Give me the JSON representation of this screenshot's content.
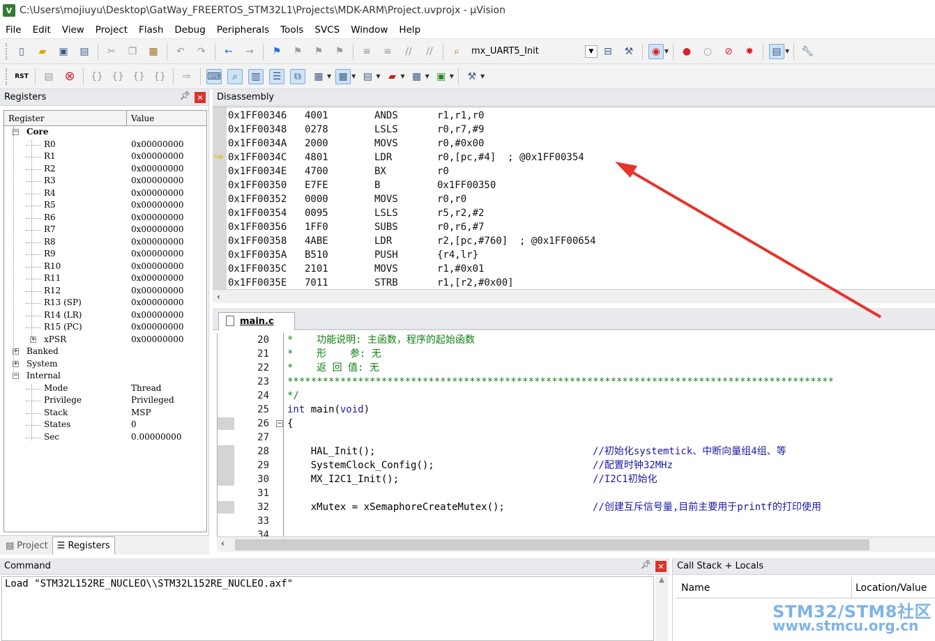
{
  "window": {
    "title": "C:\\Users\\mojiuyu\\Desktop\\GatWay_FREERTOS_STM32L1\\Projects\\MDK-ARM\\Project.uvprojx - µVision",
    "app_icon": "V"
  },
  "menu": [
    "File",
    "Edit",
    "View",
    "Project",
    "Flash",
    "Debug",
    "Peripherals",
    "Tools",
    "SVCS",
    "Window",
    "Help"
  ],
  "toolbar": {
    "target": "mx_UART5_Init"
  },
  "registers": {
    "title": "Registers",
    "col_register": "Register",
    "col_value": "Value",
    "core_label": "Core",
    "core": [
      {
        "name": "R0",
        "value": "0x00000000"
      },
      {
        "name": "R1",
        "value": "0x00000000"
      },
      {
        "name": "R2",
        "value": "0x00000000"
      },
      {
        "name": "R3",
        "value": "0x00000000"
      },
      {
        "name": "R4",
        "value": "0x00000000"
      },
      {
        "name": "R5",
        "value": "0x00000000"
      },
      {
        "name": "R6",
        "value": "0x00000000"
      },
      {
        "name": "R7",
        "value": "0x00000000"
      },
      {
        "name": "R8",
        "value": "0x00000000"
      },
      {
        "name": "R9",
        "value": "0x00000000"
      },
      {
        "name": "R10",
        "value": "0x00000000"
      },
      {
        "name": "R11",
        "value": "0x00000000"
      },
      {
        "name": "R12",
        "value": "0x00000000"
      },
      {
        "name": "R13 (SP)",
        "value": "0x00000000"
      },
      {
        "name": "R14 (LR)",
        "value": "0x00000000"
      },
      {
        "name": "R15 (PC)",
        "value": "0x00000000"
      },
      {
        "name": "xPSR",
        "value": "0x00000000"
      }
    ],
    "banked_label": "Banked",
    "system_label": "System",
    "internal_label": "Internal",
    "internal": [
      {
        "name": "Mode",
        "value": "Thread"
      },
      {
        "name": "Privilege",
        "value": "Privileged"
      },
      {
        "name": "Stack",
        "value": "MSP"
      },
      {
        "name": "States",
        "value": "0"
      },
      {
        "name": "Sec",
        "value": "0.00000000"
      }
    ],
    "tabs": [
      "Project",
      "Registers"
    ]
  },
  "disassembly": {
    "title": "Disassembly",
    "rows": [
      {
        "addr": "0x1FF00346",
        "op": "4001",
        "mn": "ANDS",
        "args": "r1,r1,r0"
      },
      {
        "addr": "0x1FF00348",
        "op": "0278",
        "mn": "LSLS",
        "args": "r0,r7,#9"
      },
      {
        "addr": "0x1FF0034A",
        "op": "2000",
        "mn": "MOVS",
        "args": "r0,#0x00"
      },
      {
        "addr": "0x1FF0034C",
        "op": "4801",
        "mn": "LDR",
        "args": "r0,[pc,#4]  ; @0x1FF00354"
      },
      {
        "addr": "0x1FF0034E",
        "op": "4700",
        "mn": "BX",
        "args": "r0"
      },
      {
        "addr": "0x1FF00350",
        "op": "E7FE",
        "mn": "B",
        "args": "0x1FF00350"
      },
      {
        "addr": "0x1FF00352",
        "op": "0000",
        "mn": "MOVS",
        "args": "r0,r0"
      },
      {
        "addr": "0x1FF00354",
        "op": "0095",
        "mn": "LSLS",
        "args": "r5,r2,#2"
      },
      {
        "addr": "0x1FF00356",
        "op": "1FF0",
        "mn": "SUBS",
        "args": "r0,r6,#7"
      },
      {
        "addr": "0x1FF00358",
        "op": "4ABE",
        "mn": "LDR",
        "args": "r2,[pc,#760]  ; @0x1FF00654"
      },
      {
        "addr": "0x1FF0035A",
        "op": "B510",
        "mn": "PUSH",
        "args": "{r4,lr}"
      },
      {
        "addr": "0x1FF0035C",
        "op": "2101",
        "mn": "MOVS",
        "args": "r1,#0x01"
      },
      {
        "addr": "0x1FF0035E",
        "op": "7011",
        "mn": "STRB",
        "args": "r1,[r2,#0x00]"
      }
    ]
  },
  "editor": {
    "tab": "main.c",
    "lines": [
      {
        "n": "20",
        "code": "*    功能说明: 主函数，程序的起始函数",
        "cls": "cmt"
      },
      {
        "n": "21",
        "code": "*    形    参: 无",
        "cls": "cmt"
      },
      {
        "n": "22",
        "code": "*    返 回 值: 无",
        "cls": "cmt"
      },
      {
        "n": "23",
        "code": "*********************************************************************************************",
        "cls": "cmt"
      },
      {
        "n": "24",
        "code": "*/",
        "cls": "cmt"
      },
      {
        "n": "25",
        "code": "int main(void)",
        "cls": "mix"
      },
      {
        "n": "26",
        "code": "{",
        "cls": ""
      },
      {
        "n": "27",
        "code": "",
        "cls": ""
      },
      {
        "n": "28",
        "code": "    HAL_Init();",
        "comment": "//初始化systemtick、中断向量组4组、等",
        "cls": ""
      },
      {
        "n": "29",
        "code": "    SystemClock_Config();",
        "comment": "//配置时钟32MHz",
        "cls": ""
      },
      {
        "n": "30",
        "code": "    MX_I2C1_Init();",
        "comment": "//I2C1初始化",
        "cls": ""
      },
      {
        "n": "31",
        "code": "",
        "cls": ""
      },
      {
        "n": "32",
        "code": "    xMutex = xSemaphoreCreateMutex();",
        "comment": "//创建互斥信号量,目前主要用于printf的打印使用",
        "cls": ""
      },
      {
        "n": "33",
        "code": "",
        "cls": ""
      },
      {
        "n": "34",
        "code": "",
        "cls": ""
      }
    ]
  },
  "command": {
    "title": "Command",
    "text": "Load \"STM32L152RE_NUCLEO\\\\STM32L152RE_NUCLEO.axf\""
  },
  "callstack": {
    "title": "Call Stack + Locals",
    "col_name": "Name",
    "col_location": "Location/Value"
  },
  "watermark": {
    "line1": "STM32/STM8社区",
    "line2": "www.stmcu.org.cn"
  },
  "colors": {
    "accent": "#3a5a8a",
    "annotation": "#e8332b",
    "comment": "#108010",
    "keyword": "#1a1aa6"
  }
}
